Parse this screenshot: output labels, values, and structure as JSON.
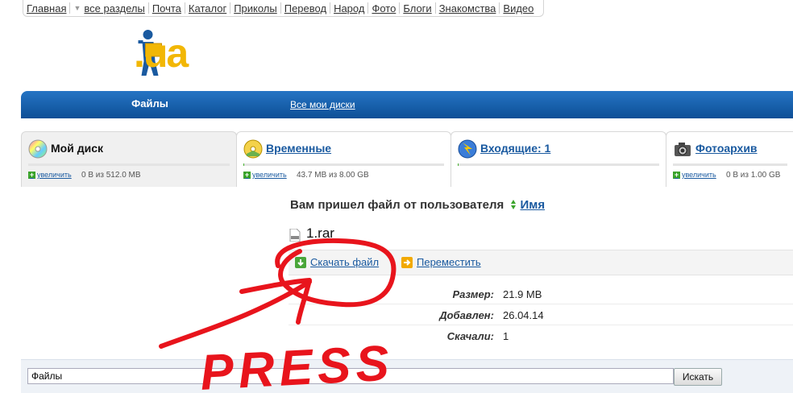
{
  "topnav": {
    "items": [
      "Главная",
      "все разделы",
      "Почта",
      "Каталог",
      "Приколы",
      "Перевод",
      "Народ",
      "Фото",
      "Блоги",
      "Знакомства",
      "Видео"
    ]
  },
  "logo": {
    "text": ".ua"
  },
  "bluebar": {
    "files_label": "Файлы",
    "all_disks_label": "Все мои диски"
  },
  "tabs": [
    {
      "title": "Мой диск",
      "enlarge": "увеличить",
      "usage": "0 В из 512.0 MB",
      "fill": 0.0
    },
    {
      "title": "Временные",
      "enlarge": "увеличить",
      "usage": "43.7 MB из 8.00 GB",
      "fill": 0.006
    },
    {
      "title": "Входящие: 1",
      "enlarge": "",
      "usage": "",
      "fill": 0.004
    },
    {
      "title": "Фотоархив",
      "enlarge": "увеличить",
      "usage": "0 В из 1.00 GB",
      "fill": 0.0
    }
  ],
  "main": {
    "heading": "Вам пришел файл от пользователя",
    "user": "Имя",
    "filename": "1.rar",
    "download_label": "Скачать файл",
    "move_label": "Переместить",
    "meta": [
      {
        "key": "Размер:",
        "value": "21.9 MB"
      },
      {
        "key": "Добавлен:",
        "value": "26.04.14"
      },
      {
        "key": "Скачали:",
        "value": "1"
      }
    ]
  },
  "search": {
    "value": "Файлы",
    "button": "Искать"
  },
  "annotation": {
    "text": "PRESS",
    "color": "#e8141c"
  },
  "colors": {
    "brand_blue": "#1a5aa0",
    "logo_yellow": "#f2b705",
    "bar_green": "#49b233"
  }
}
